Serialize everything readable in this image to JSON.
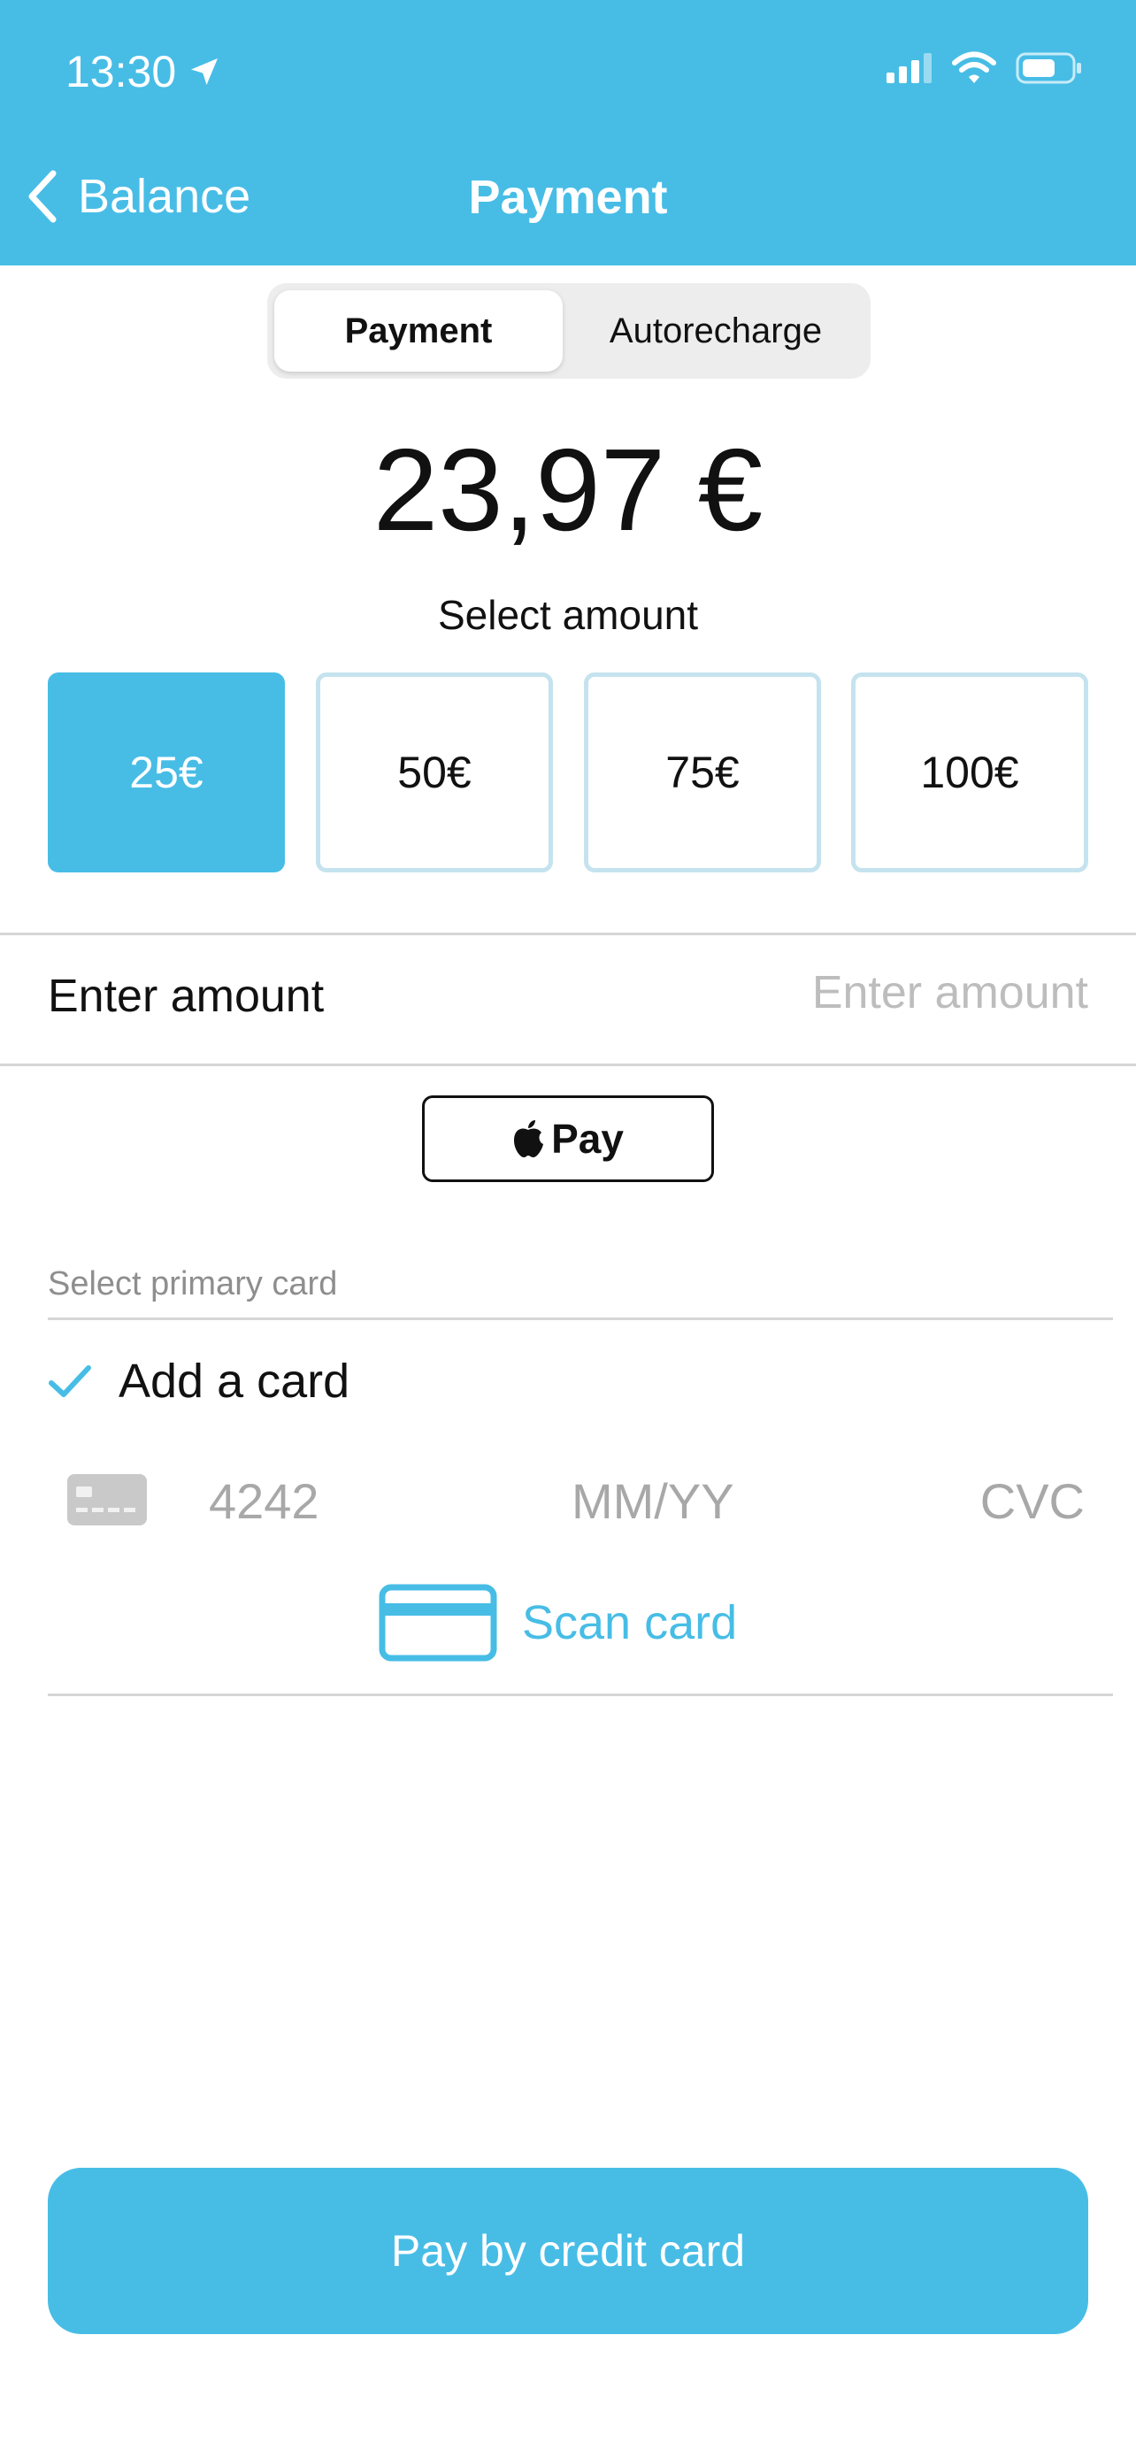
{
  "colors": {
    "accent": "#47bde6",
    "selected_border": "#c5e3ee",
    "placeholder": "#bdbdbd"
  },
  "status_bar": {
    "time": "13:30"
  },
  "nav": {
    "back_label": "Balance",
    "title": "Payment"
  },
  "segments": {
    "payment": "Payment",
    "autorecharge": "Autorecharge",
    "selected": "Payment"
  },
  "balance": "23,97 €",
  "select_amount_label": "Select amount",
  "amounts": [
    {
      "label": "25€",
      "selected": true
    },
    {
      "label": "50€",
      "selected": false
    },
    {
      "label": "75€",
      "selected": false
    },
    {
      "label": "100€",
      "selected": false
    }
  ],
  "enter_amount": {
    "label": "Enter amount",
    "placeholder": "Enter amount",
    "value": ""
  },
  "apple_pay": {
    "label": "Pay"
  },
  "primary_card_label": "Select primary card",
  "add_card_label": "Add a card",
  "card_form": {
    "number_placeholder": "4242",
    "expiry_placeholder": "MM/YY",
    "cvc_placeholder": "CVC"
  },
  "scan_card_label": "Scan card",
  "pay_button_label": "Pay by credit card"
}
